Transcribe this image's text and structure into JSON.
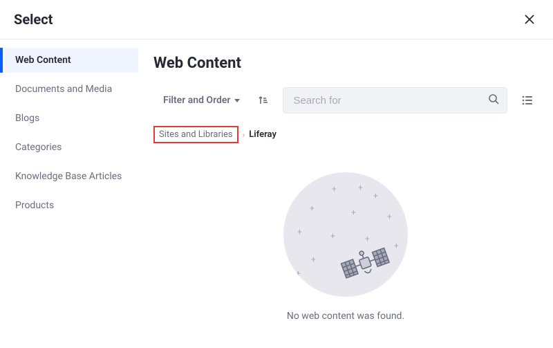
{
  "dialog": {
    "title": "Select"
  },
  "sidebar": {
    "items": [
      {
        "label": "Web Content",
        "active": true
      },
      {
        "label": "Documents and Media",
        "active": false
      },
      {
        "label": "Blogs",
        "active": false
      },
      {
        "label": "Categories",
        "active": false
      },
      {
        "label": "Knowledge Base Articles",
        "active": false
      },
      {
        "label": "Products",
        "active": false
      }
    ]
  },
  "main": {
    "title": "Web Content",
    "filter_label": "Filter and Order",
    "search_placeholder": "Search for",
    "breadcrumb": {
      "root": "Sites and Libraries",
      "current": "Liferay"
    },
    "empty_message": "No web content was found."
  }
}
